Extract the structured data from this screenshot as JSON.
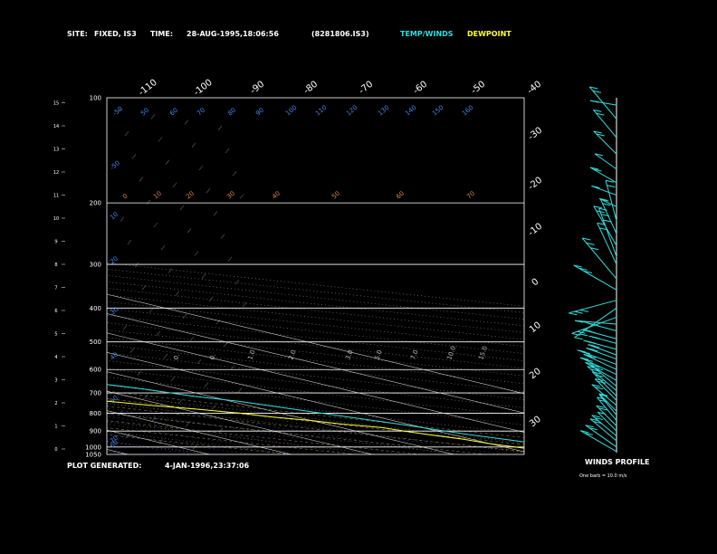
{
  "header": {
    "site_label": "SITE:",
    "site_value": "FIXED, IS3",
    "time_label": "TIME:",
    "time_value": "28-AUG-1995,18:06:56",
    "file_value": "(8281806.IS3)",
    "legend_temp": "TEMP/WINDS",
    "legend_dew": "DEWPOINT"
  },
  "footer": {
    "generated_label": "PLOT GENERATED:",
    "generated_value": "4-JAN-1996,23:37:06"
  },
  "winds_panel": {
    "title": "WINDS PROFILE",
    "note": "One barb = 10.0 m/s"
  },
  "colors": {
    "temp": "#33dddd",
    "dew": "#ffff33",
    "grid": "#ffffff",
    "dry_adiabat": "#bbbbbb",
    "moist_adiabat": "#ccaa66",
    "mixing_ratio": "#4466bb",
    "isotherm_label": "#4488ee",
    "theta_label": "#dd8844"
  },
  "chart_data": {
    "type": "line",
    "plot": "skew-t log-p",
    "pressure_ticks": [
      "100",
      "200",
      "300",
      "400",
      "500",
      "600",
      "700",
      "800",
      "900",
      "1000",
      "1050"
    ],
    "pressure_values": [
      100,
      200,
      300,
      400,
      500,
      600,
      700,
      800,
      900,
      1000,
      1050
    ],
    "height_ticks": [
      "0",
      "1",
      "2",
      "3",
      "4",
      "5",
      "6",
      "7",
      "8",
      "9",
      "10",
      "11",
      "12",
      "13",
      "14",
      "15"
    ],
    "height_values_km": [
      0,
      1,
      2,
      3,
      4,
      5,
      6,
      7,
      8,
      9,
      10,
      11,
      12,
      13,
      14,
      15
    ],
    "top_skew_labels": [
      "-110",
      "-100",
      "-90",
      "-80",
      "-70",
      "-60",
      "-50",
      "-40"
    ],
    "top_skew_values": [
      -110,
      -100,
      -90,
      -80,
      -70,
      -60,
      -50,
      -40
    ],
    "right_skew_labels": [
      "-30",
      "-20",
      "-10",
      "0",
      "10",
      "20",
      "30"
    ],
    "right_skew_values": [
      -30,
      -20,
      -10,
      0,
      10,
      20,
      30
    ],
    "isotherm_labels_top": [
      "-50",
      "50",
      "60",
      "70",
      "80",
      "90",
      "100",
      "110",
      "120",
      "130",
      "140",
      "150",
      "160"
    ],
    "isotherm_labels_top_values": [
      -50,
      50,
      60,
      70,
      80,
      90,
      100,
      110,
      120,
      130,
      140,
      150,
      160
    ],
    "isotherm_labels_left": [
      "-50",
      "10",
      "20",
      "30",
      "40",
      "50",
      "60",
      "70"
    ],
    "theta_labels": [
      "0",
      "10",
      "20",
      "30",
      "40",
      "50",
      "60",
      "70"
    ],
    "mixing_labels": [
      "0.",
      "0.",
      "1.0",
      "2.0",
      "3.0",
      "5.0",
      "7.0",
      "10.0",
      "15.0"
    ],
    "series": [
      {
        "name": "TEMP/WINDS",
        "key": "temp",
        "points": [
          [
            1040,
            29
          ],
          [
            1010,
            29
          ],
          [
            980,
            26
          ],
          [
            950,
            24
          ],
          [
            920,
            22
          ],
          [
            900,
            21
          ],
          [
            860,
            19
          ],
          [
            830,
            17
          ],
          [
            800,
            15
          ],
          [
            770,
            13
          ],
          [
            740,
            11
          ],
          [
            715,
            8
          ],
          [
            700,
            7
          ],
          [
            680,
            5.5
          ],
          [
            650,
            2
          ],
          [
            620,
            0
          ],
          [
            600,
            -2
          ],
          [
            580,
            -4
          ],
          [
            560,
            -6
          ],
          [
            540,
            -7
          ],
          [
            520,
            -8
          ],
          [
            500,
            -10
          ],
          [
            480,
            -11.5
          ],
          [
            450,
            -14.5
          ],
          [
            420,
            -18
          ],
          [
            400,
            -21
          ],
          [
            380,
            -24
          ],
          [
            360,
            -27
          ],
          [
            340,
            -30
          ],
          [
            320,
            -33
          ],
          [
            300,
            -37
          ],
          [
            280,
            -40
          ],
          [
            260,
            -44
          ],
          [
            240,
            -48
          ],
          [
            220,
            -52
          ],
          [
            210,
            -55
          ],
          [
            200,
            -57
          ],
          [
            190,
            -59
          ],
          [
            180,
            -61.5
          ],
          [
            170,
            -64
          ],
          [
            160,
            -66
          ],
          [
            150,
            -68
          ],
          [
            140,
            -70
          ],
          [
            130,
            -72
          ],
          [
            120,
            -74
          ],
          [
            110,
            -76
          ],
          [
            103,
            -77
          ],
          [
            100,
            -76
          ]
        ]
      },
      {
        "name": "DEWPOINT",
        "key": "dew",
        "points": [
          [
            1040,
            23
          ],
          [
            1010,
            22
          ],
          [
            980,
            20
          ],
          [
            950,
            19
          ],
          [
            920,
            17
          ],
          [
            900,
            16
          ],
          [
            880,
            15
          ],
          [
            860,
            12
          ],
          [
            840,
            10
          ],
          [
            820,
            7
          ],
          [
            800,
            5
          ],
          [
            780,
            2
          ],
          [
            760,
            -2
          ],
          [
            740,
            -5
          ],
          [
            720,
            -9
          ],
          [
            710,
            -10
          ],
          [
            700,
            -10
          ],
          [
            690,
            -8
          ],
          [
            680,
            -5
          ],
          [
            660,
            -2
          ],
          [
            640,
            0
          ],
          [
            620,
            -2
          ],
          [
            610,
            -5
          ],
          [
            600,
            -12
          ],
          [
            595,
            -22
          ],
          [
            590,
            -34
          ],
          [
            585,
            -44
          ],
          [
            580,
            -48
          ],
          [
            560,
            -50
          ],
          [
            545,
            -55
          ],
          [
            535,
            -52
          ],
          [
            525,
            -60
          ],
          [
            510,
            -70
          ],
          [
            495,
            -65
          ],
          [
            485,
            -76
          ],
          [
            470,
            -68
          ],
          [
            460,
            -74
          ],
          [
            450,
            -78
          ],
          [
            440,
            -72
          ],
          [
            430,
            -72
          ],
          [
            420,
            -70
          ],
          [
            410,
            -67
          ],
          [
            400,
            -65
          ],
          [
            390,
            -58
          ],
          [
            380,
            -53
          ],
          [
            370,
            -48
          ],
          [
            360,
            -47
          ],
          [
            350,
            -46
          ],
          [
            340,
            -47
          ],
          [
            330,
            -45
          ],
          [
            320,
            -44
          ],
          [
            310,
            -42
          ],
          [
            300,
            -41
          ],
          [
            290,
            -42
          ],
          [
            280,
            -40
          ],
          [
            270,
            -42
          ],
          [
            260,
            -40
          ],
          [
            250,
            -42
          ],
          [
            240,
            -47
          ],
          [
            230,
            -51
          ],
          [
            220,
            -56
          ],
          [
            210,
            -60
          ],
          [
            200,
            -63
          ],
          [
            190,
            -67
          ],
          [
            180,
            -71
          ],
          [
            170,
            -74
          ],
          [
            160,
            -76
          ],
          [
            150,
            -78
          ],
          [
            140,
            -80
          ],
          [
            130,
            -80
          ],
          [
            120,
            -78
          ],
          [
            110,
            -78
          ],
          [
            100,
            -76
          ]
        ]
      }
    ],
    "winds": [
      {
        "p": 1030,
        "dir": 240,
        "spd": 22
      },
      {
        "p": 1000,
        "dir": 235,
        "spd": 20
      },
      {
        "p": 960,
        "dir": 230,
        "spd": 18
      },
      {
        "p": 930,
        "dir": 230,
        "spd": 17
      },
      {
        "p": 900,
        "dir": 225,
        "spd": 14
      },
      {
        "p": 870,
        "dir": 225,
        "spd": 15
      },
      {
        "p": 840,
        "dir": 220,
        "spd": 16
      },
      {
        "p": 810,
        "dir": 220,
        "spd": 14
      },
      {
        "p": 790,
        "dir": 225,
        "spd": 13
      },
      {
        "p": 760,
        "dir": 230,
        "spd": 17
      },
      {
        "p": 735,
        "dir": 225,
        "spd": 16
      },
      {
        "p": 715,
        "dir": 225,
        "spd": 18
      },
      {
        "p": 690,
        "dir": 230,
        "spd": 20
      },
      {
        "p": 670,
        "dir": 230,
        "spd": 17
      },
      {
        "p": 645,
        "dir": 240,
        "spd": 19
      },
      {
        "p": 620,
        "dir": 245,
        "spd": 21
      },
      {
        "p": 600,
        "dir": 245,
        "spd": 19
      },
      {
        "p": 580,
        "dir": 250,
        "spd": 22
      },
      {
        "p": 560,
        "dir": 250,
        "spd": 17
      },
      {
        "p": 545,
        "dir": 250,
        "spd": 16
      },
      {
        "p": 525,
        "dir": 255,
        "spd": 18
      },
      {
        "p": 505,
        "dir": 255,
        "spd": 15
      },
      {
        "p": 490,
        "dir": 255,
        "spd": 18
      },
      {
        "p": 465,
        "dir": 255,
        "spd": 16
      },
      {
        "p": 445,
        "dir": 265,
        "spd": 22
      },
      {
        "p": 425,
        "dir": 290,
        "spd": 25
      },
      {
        "p": 400,
        "dir": 305,
        "spd": 27
      },
      {
        "p": 380,
        "dir": 285,
        "spd": 26
      },
      {
        "p": 355,
        "dir": 240,
        "spd": 26
      },
      {
        "p": 330,
        "dir": 220,
        "spd": 28
      },
      {
        "p": 300,
        "dir": 205,
        "spd": 24
      },
      {
        "p": 285,
        "dir": 200,
        "spd": 27
      },
      {
        "p": 265,
        "dir": 210,
        "spd": 24
      },
      {
        "p": 245,
        "dir": 205,
        "spd": 20
      },
      {
        "p": 225,
        "dir": 195,
        "spd": 22
      },
      {
        "p": 205,
        "dir": 245,
        "spd": 10
      },
      {
        "p": 190,
        "dir": 250,
        "spd": 14
      },
      {
        "p": 175,
        "dir": 240,
        "spd": 16
      },
      {
        "p": 160,
        "dir": 235,
        "spd": 14
      },
      {
        "p": 145,
        "dir": 225,
        "spd": 17
      },
      {
        "p": 130,
        "dir": 220,
        "spd": 19
      },
      {
        "p": 115,
        "dir": 220,
        "spd": 22
      },
      {
        "p": 105,
        "dir": 260,
        "spd": 14
      }
    ]
  }
}
